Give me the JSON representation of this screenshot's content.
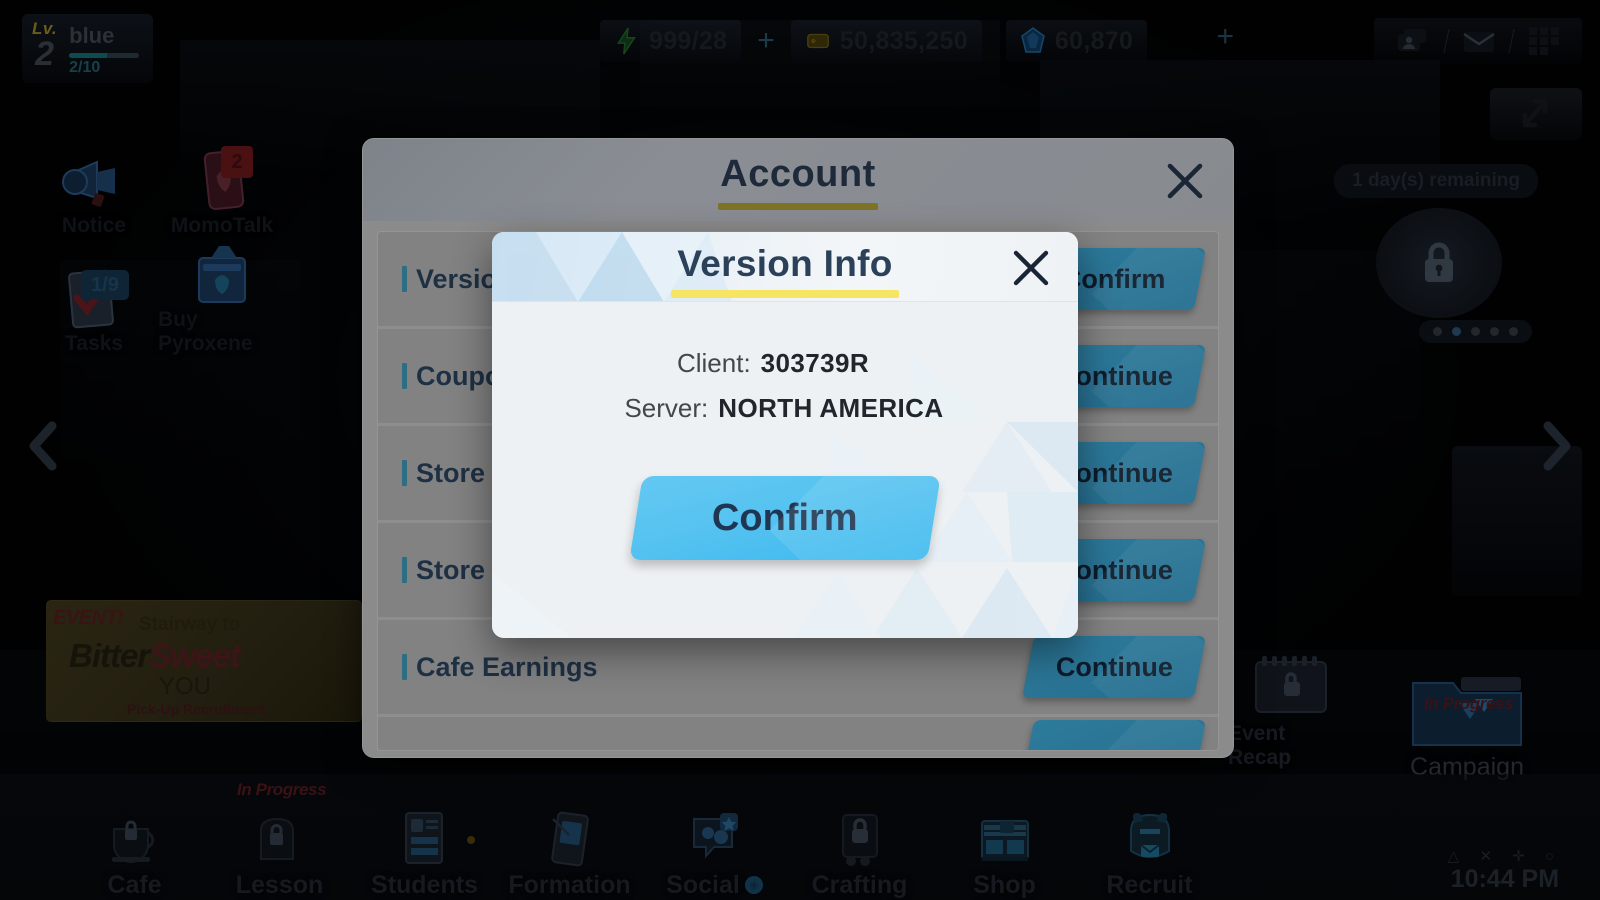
{
  "player": {
    "lv_label": "Lv.",
    "level": "2",
    "name": "blue",
    "xp": "2/10"
  },
  "currency": {
    "ap": "999/28",
    "ap_icon": "lightning-bolt-icon",
    "plus_label": "+",
    "credits": "50,835,250",
    "credits_icon": "credit-ticket-icon",
    "pyroxene": "60,870",
    "pyroxene_icon": "pyroxene-gem-icon"
  },
  "top_right": {
    "plus_label": "+",
    "icons": [
      "profile-card-icon",
      "mail-icon",
      "menu-grid-icon"
    ]
  },
  "left_menu": [
    {
      "label": "Notice",
      "icon": "megaphone-icon",
      "badge": ""
    },
    {
      "label": "MomoTalk",
      "icon": "phone-icon",
      "badge": "2"
    },
    {
      "label": "Tasks",
      "icon": "clipboard-check-icon",
      "badge": "1/9"
    },
    {
      "label": "Buy Pyroxene",
      "icon": "shopping-bag-icon",
      "badge": ""
    }
  ],
  "event_banner": {
    "tag": "EVENT!",
    "line1": "Stairway to",
    "line2_a": "Bitter",
    "line2_b": "Sweet",
    "line3": "YOU",
    "pill": "Pick-Up Recruitment"
  },
  "right_widgets": {
    "expand_icon": "expand-arrows-icon",
    "days_remaining": "1 day(s) remaining",
    "lock_icon": "lock-icon",
    "carousel_dots": 5,
    "carousel_active": 1
  },
  "shortcuts": [
    {
      "label": "Event Recap",
      "icon": "calendar-lock-icon",
      "badge": ""
    },
    {
      "label": "Campaign",
      "icon": "campaign-folder-icon",
      "badge": "In Progress"
    }
  ],
  "bottom_nav": [
    {
      "label": "Cafe",
      "icon": "coffee-cup-icon",
      "locked": true,
      "badge": ""
    },
    {
      "label": "Lesson",
      "icon": "backpack-icon",
      "locked": true,
      "badge": "In Progress"
    },
    {
      "label": "Students",
      "icon": "student-list-icon",
      "locked": false,
      "badge": ""
    },
    {
      "label": "Formation",
      "icon": "tablet-formation-icon",
      "locked": false,
      "badge": ""
    },
    {
      "label": "Social",
      "icon": "social-chat-icon",
      "locked": false,
      "badge": "+"
    },
    {
      "label": "Crafting",
      "icon": "crafting-lock-icon",
      "locked": true,
      "badge": ""
    },
    {
      "label": "Shop",
      "icon": "store-icon",
      "locked": false,
      "badge": ""
    },
    {
      "label": "Recruit",
      "icon": "recruit-character-icon",
      "locked": false,
      "badge": ""
    }
  ],
  "system": {
    "ps_glyphs": "△ ✕ ✛ ○",
    "clock": "10:44 PM"
  },
  "account_dialog": {
    "title": "Account",
    "close_icon": "close-icon",
    "rows": [
      {
        "label": "Version",
        "button": "Confirm"
      },
      {
        "label": "Coupon",
        "button": "Continue"
      },
      {
        "label": "Store a",
        "button": "Continue"
      },
      {
        "label": "Store a",
        "button": "Continue"
      },
      {
        "label": "Cafe Earnings",
        "button": "Continue"
      }
    ]
  },
  "version_modal": {
    "title": "Version Info",
    "close_icon": "close-icon",
    "client_key": "Client:",
    "client_value": "303739R",
    "server_key": "Server:",
    "server_value": "NORTH AMERICA",
    "confirm_label": "Confirm",
    "accent_underline": "#f5e563",
    "confirm_color": "#57c3f0"
  }
}
